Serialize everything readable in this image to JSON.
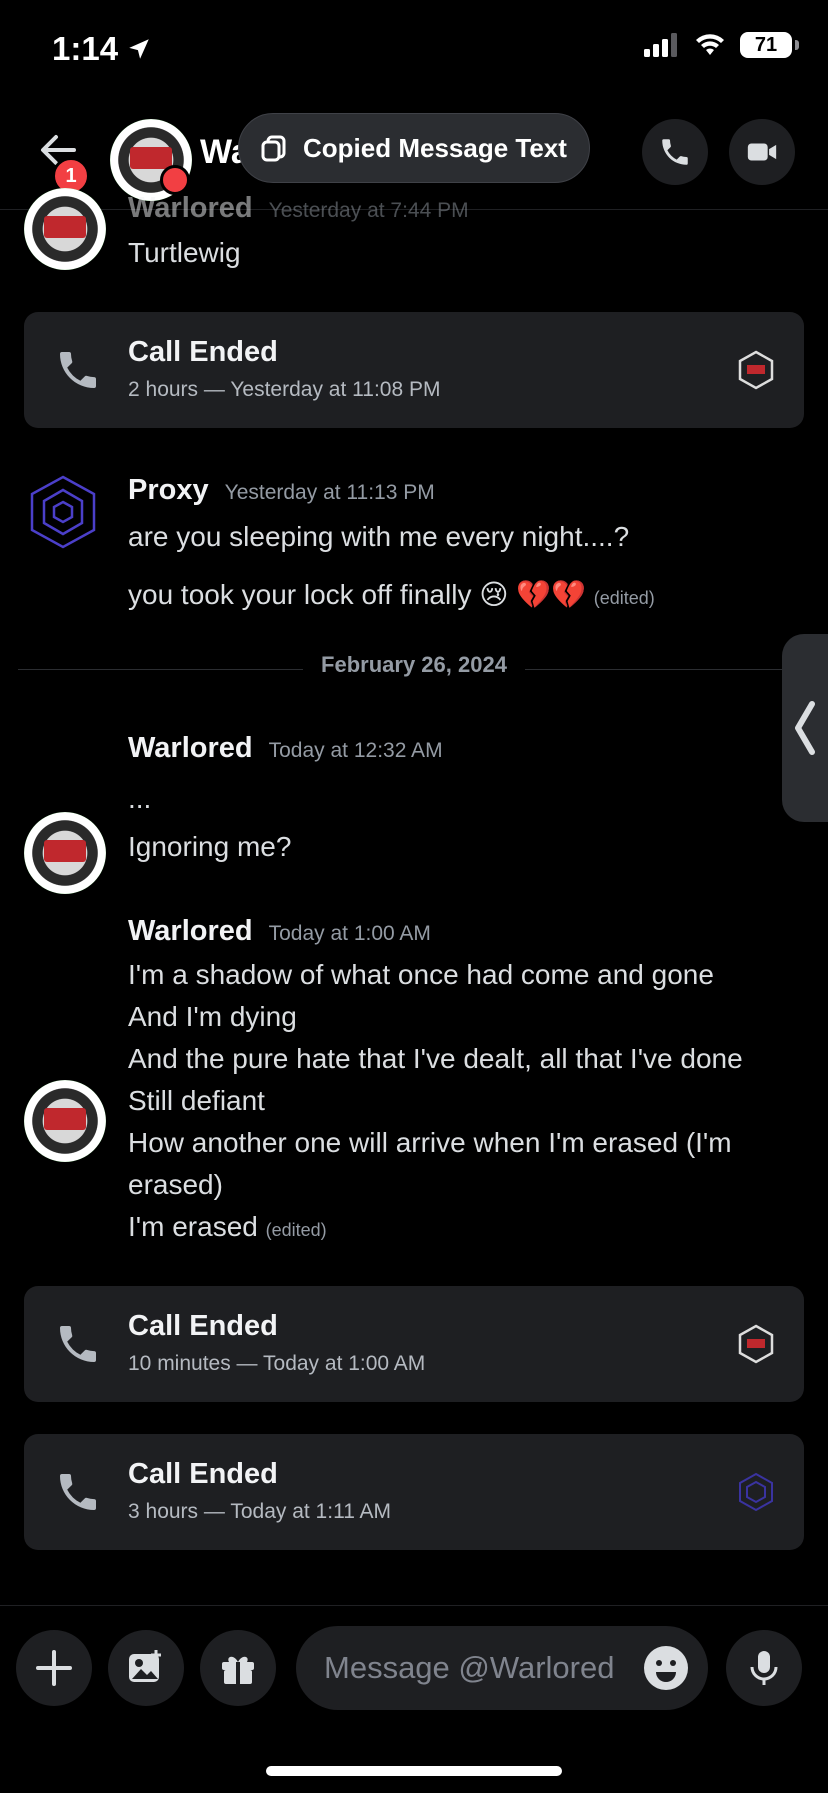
{
  "status": {
    "time": "1:14",
    "battery": "71"
  },
  "header": {
    "name": "Warlored",
    "badge": "1",
    "toast": "Copied Message Text"
  },
  "messages": [
    {
      "author": "Warlored",
      "timestamp": "Yesterday at 7:44 PM",
      "lines": [
        "Turtlewig"
      ]
    },
    {
      "author": "Proxy",
      "timestamp": "Yesterday at 11:13 PM",
      "lines": [
        "are you sleeping with me every night....?",
        "you took your lock off finally"
      ],
      "emoji": "😢 💔💔",
      "edited": "(edited)"
    },
    {
      "author": "Warlored",
      "timestamp": "Today at 12:32 AM",
      "lines": [
        "...",
        "Ignoring me?"
      ]
    },
    {
      "author": "Warlored",
      "timestamp": "Today at 1:00 AM",
      "lines": [
        "I'm a shadow of what once had come and gone",
        "And I'm dying",
        "And the pure hate that I've dealt, all that I've done",
        "Still defiant",
        "How another one will arrive when I'm erased (I'm",
        "erased)",
        "I'm erased"
      ],
      "edited": "(edited)"
    }
  ],
  "calls": [
    {
      "title": "Call Ended",
      "subtitle": "2 hours — Yesterday at 11:08 PM"
    },
    {
      "title": "Call Ended",
      "subtitle": "10 minutes — Today at 1:00 AM"
    },
    {
      "title": "Call Ended",
      "subtitle": "3 hours — Today at 1:11 AM"
    }
  ],
  "divider": {
    "date": "February 26, 2024"
  },
  "composer": {
    "placeholder": "Message @Warlored"
  },
  "colors": {
    "background": "#000000",
    "card": "#1e1f22",
    "badge": "#f23f43",
    "muted": "#949ba4"
  }
}
